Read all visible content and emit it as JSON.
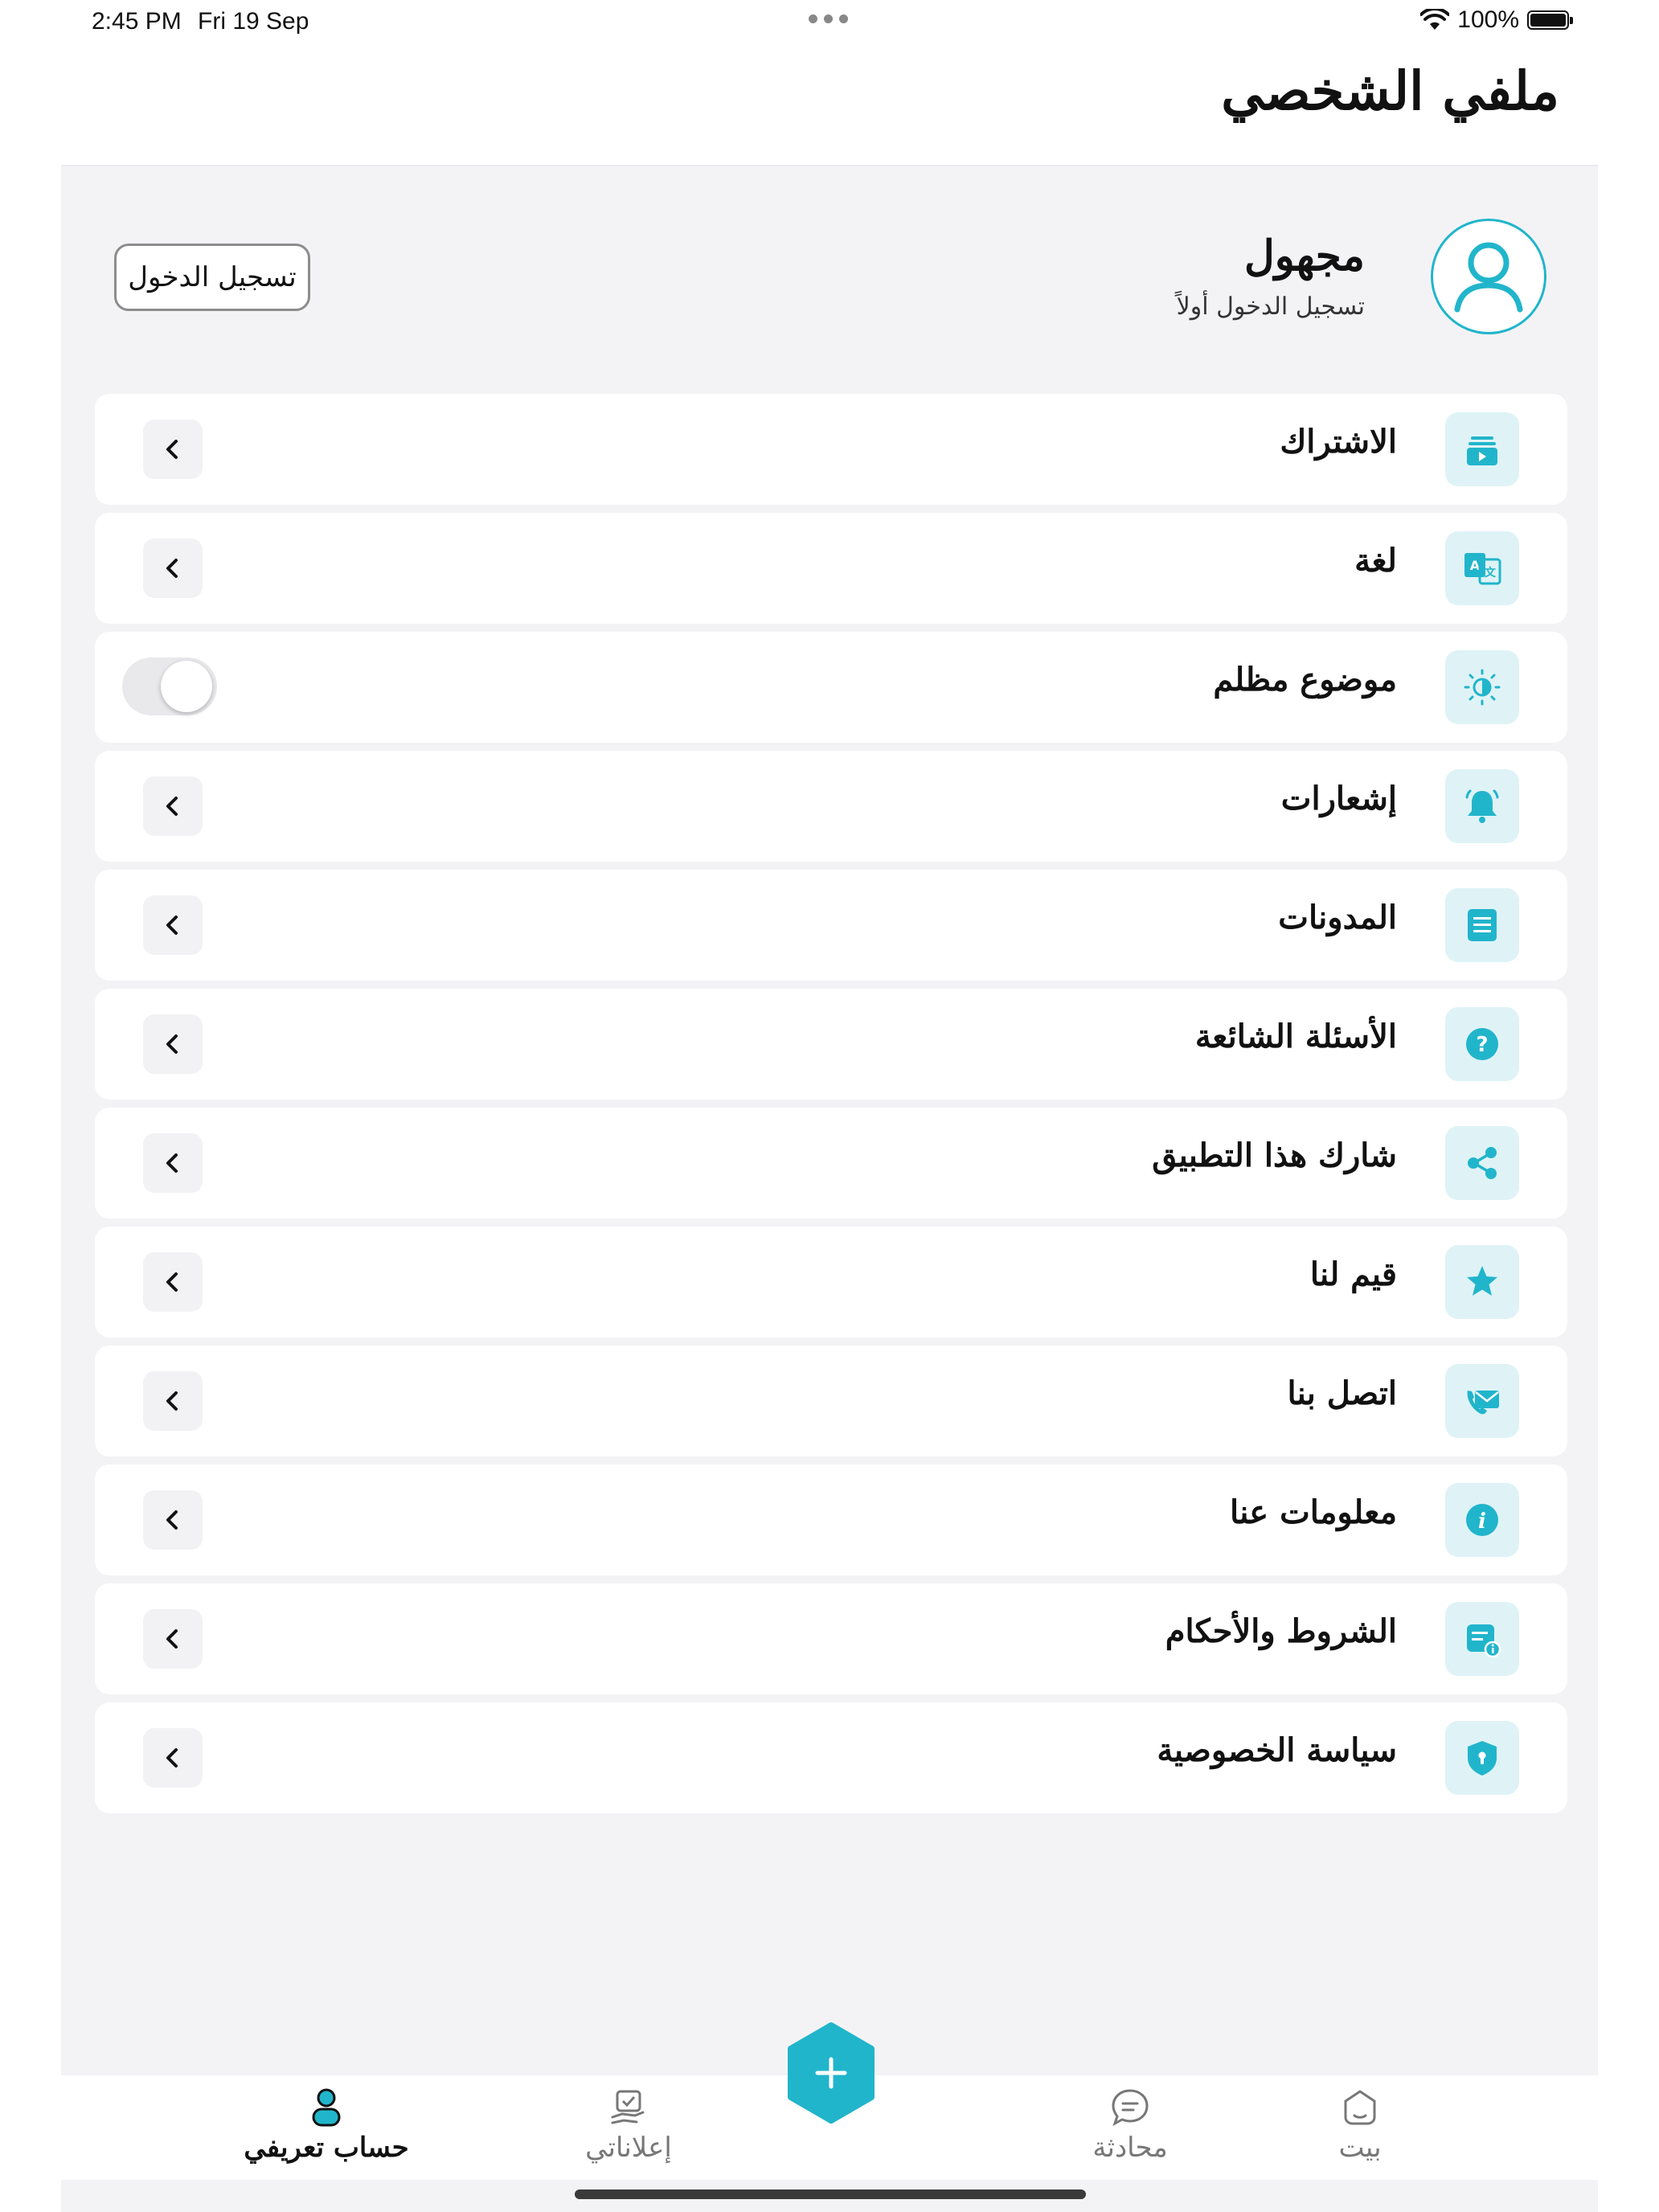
{
  "status_bar": {
    "time": "2:45 PM",
    "date": "Fri 19 Sep",
    "battery": "100%"
  },
  "header": {
    "title": "ملفي الشخصي"
  },
  "profile": {
    "name": "مجهول",
    "subtitle": "تسجيل الدخول أولاً",
    "login_button": "تسجيل الدخول"
  },
  "menu": {
    "items": [
      {
        "label": "الاشتراك",
        "icon": "subscription-icon"
      },
      {
        "label": "لغة",
        "icon": "translate-icon"
      },
      {
        "label": "موضوع مظلم",
        "icon": "brightness-icon",
        "toggle": false
      },
      {
        "label": "إشعارات",
        "icon": "bell-icon"
      },
      {
        "label": "المدونات",
        "icon": "blog-icon"
      },
      {
        "label": "الأسئلة الشائعة",
        "icon": "help-icon"
      },
      {
        "label": "شارك هذا التطبيق",
        "icon": "share-icon"
      },
      {
        "label": "قيم لنا",
        "icon": "star-icon"
      },
      {
        "label": "اتصل بنا",
        "icon": "contact-icon"
      },
      {
        "label": "معلومات عنا",
        "icon": "info-icon"
      },
      {
        "label": "الشروط والأحكام",
        "icon": "terms-icon"
      },
      {
        "label": "سياسة الخصوصية",
        "icon": "shield-icon"
      }
    ]
  },
  "tabbar": {
    "tabs": [
      {
        "label": "حساب تعريفي",
        "icon": "person-icon",
        "active": true
      },
      {
        "label": "إعلاناتي",
        "icon": "ads-icon",
        "active": false
      },
      {
        "label": "محادثة",
        "icon": "chat-icon",
        "active": false
      },
      {
        "label": "بيت",
        "icon": "home-icon",
        "active": false
      }
    ],
    "fab_icon": "plus-icon"
  },
  "colors": {
    "accent": "#21b5cb",
    "icon_bg": "#dff3f7",
    "background": "#f3f3f6"
  }
}
